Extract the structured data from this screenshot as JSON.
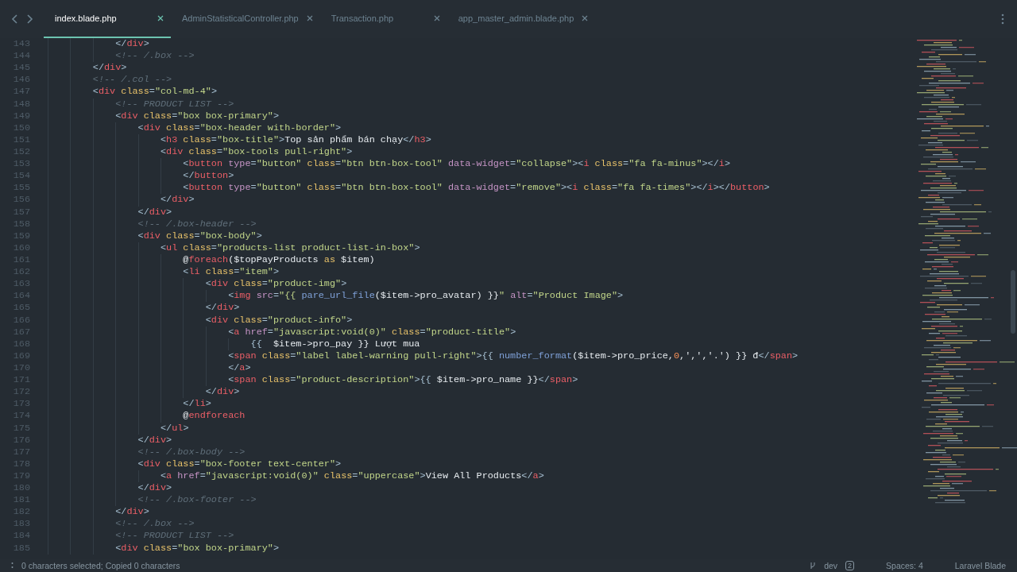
{
  "tabs": [
    {
      "label": "index.blade.php",
      "selected": true
    },
    {
      "label": "AdminStatisticalController.php",
      "selected": false
    },
    {
      "label": "Transaction.php",
      "selected": false
    },
    {
      "label": "app_master_admin.blade.php",
      "selected": false
    }
  ],
  "editor": {
    "lines": [
      {
        "number": "143",
        "tokens": [
          {
            "kind": "p",
            "text": "            </"
          },
          {
            "kind": "tag",
            "text": "div"
          },
          {
            "kind": "p",
            "text": ">"
          }
        ]
      },
      {
        "number": "144",
        "tokens": [
          {
            "kind": "c",
            "text": "            <!-- /.box -->"
          }
        ]
      },
      {
        "number": "145",
        "tokens": [
          {
            "kind": "p",
            "text": "        </"
          },
          {
            "kind": "tag",
            "text": "div"
          },
          {
            "kind": "p",
            "text": ">"
          }
        ]
      },
      {
        "number": "146",
        "tokens": [
          {
            "kind": "c",
            "text": "        <!-- /.col -->"
          }
        ]
      },
      {
        "number": "147",
        "tokens": [
          {
            "kind": "p",
            "text": "        <"
          },
          {
            "kind": "tag",
            "text": "div"
          },
          {
            "kind": "at",
            "text": " class"
          },
          {
            "kind": "p",
            "text": "="
          },
          {
            "kind": "s",
            "text": "\"col-md-4\""
          },
          {
            "kind": "p",
            "text": ">"
          }
        ]
      },
      {
        "number": "148",
        "tokens": [
          {
            "kind": "c",
            "text": "            <!-- PRODUCT LIST -->"
          }
        ]
      },
      {
        "number": "149",
        "tokens": [
          {
            "kind": "p",
            "text": "            <"
          },
          {
            "kind": "tag",
            "text": "div"
          },
          {
            "kind": "at",
            "text": " class"
          },
          {
            "kind": "p",
            "text": "="
          },
          {
            "kind": "s",
            "text": "\"box box-primary\""
          },
          {
            "kind": "p",
            "text": ">"
          }
        ]
      },
      {
        "number": "150",
        "tokens": [
          {
            "kind": "p",
            "text": "                <"
          },
          {
            "kind": "tag",
            "text": "div"
          },
          {
            "kind": "at",
            "text": " class"
          },
          {
            "kind": "p",
            "text": "="
          },
          {
            "kind": "s",
            "text": "\"box-header with-border\""
          },
          {
            "kind": "p",
            "text": ">"
          }
        ]
      },
      {
        "number": "151",
        "tokens": [
          {
            "kind": "p",
            "text": "                    <"
          },
          {
            "kind": "tag",
            "text": "h3"
          },
          {
            "kind": "at",
            "text": " class"
          },
          {
            "kind": "p",
            "text": "="
          },
          {
            "kind": "s",
            "text": "\"box-title\""
          },
          {
            "kind": "p",
            "text": ">"
          },
          {
            "kind": "t",
            "text": "Top sản phẩm bán chạy"
          },
          {
            "kind": "p",
            "text": "</"
          },
          {
            "kind": "tag",
            "text": "h3"
          },
          {
            "kind": "p",
            "text": ">"
          }
        ]
      },
      {
        "number": "152",
        "tokens": [
          {
            "kind": "p",
            "text": "                    <"
          },
          {
            "kind": "tag",
            "text": "div"
          },
          {
            "kind": "at",
            "text": " class"
          },
          {
            "kind": "p",
            "text": "="
          },
          {
            "kind": "s",
            "text": "\"box-tools pull-right\""
          },
          {
            "kind": "p",
            "text": ">"
          }
        ]
      },
      {
        "number": "153",
        "tokens": [
          {
            "kind": "p",
            "text": "                        <"
          },
          {
            "kind": "tag",
            "text": "button"
          },
          {
            "kind": "ap",
            "text": " type"
          },
          {
            "kind": "p",
            "text": "="
          },
          {
            "kind": "s",
            "text": "\"button\""
          },
          {
            "kind": "at",
            "text": " class"
          },
          {
            "kind": "p",
            "text": "="
          },
          {
            "kind": "s",
            "text": "\"btn btn-box-tool\""
          },
          {
            "kind": "ap",
            "text": " data-widget"
          },
          {
            "kind": "p",
            "text": "="
          },
          {
            "kind": "s",
            "text": "\"collapse\""
          },
          {
            "kind": "p",
            "text": "><"
          },
          {
            "kind": "tag",
            "text": "i"
          },
          {
            "kind": "at",
            "text": " class"
          },
          {
            "kind": "p",
            "text": "="
          },
          {
            "kind": "s",
            "text": "\"fa fa-minus\""
          },
          {
            "kind": "p",
            "text": "></"
          },
          {
            "kind": "tag",
            "text": "i"
          },
          {
            "kind": "p",
            "text": ">"
          }
        ]
      },
      {
        "number": "154",
        "tokens": [
          {
            "kind": "p",
            "text": "                        </"
          },
          {
            "kind": "tag",
            "text": "button"
          },
          {
            "kind": "p",
            "text": ">"
          }
        ]
      },
      {
        "number": "155",
        "tokens": [
          {
            "kind": "p",
            "text": "                        <"
          },
          {
            "kind": "tag",
            "text": "button"
          },
          {
            "kind": "ap",
            "text": " type"
          },
          {
            "kind": "p",
            "text": "="
          },
          {
            "kind": "s",
            "text": "\"button\""
          },
          {
            "kind": "at",
            "text": " class"
          },
          {
            "kind": "p",
            "text": "="
          },
          {
            "kind": "s",
            "text": "\"btn btn-box-tool\""
          },
          {
            "kind": "ap",
            "text": " data-widget"
          },
          {
            "kind": "p",
            "text": "="
          },
          {
            "kind": "s",
            "text": "\"remove\""
          },
          {
            "kind": "p",
            "text": "><"
          },
          {
            "kind": "tag",
            "text": "i"
          },
          {
            "kind": "at",
            "text": " class"
          },
          {
            "kind": "p",
            "text": "="
          },
          {
            "kind": "s",
            "text": "\"fa fa-times\""
          },
          {
            "kind": "p",
            "text": "></"
          },
          {
            "kind": "tag",
            "text": "i"
          },
          {
            "kind": "p",
            "text": "></"
          },
          {
            "kind": "tag",
            "text": "button"
          },
          {
            "kind": "p",
            "text": ">"
          }
        ]
      },
      {
        "number": "156",
        "tokens": [
          {
            "kind": "p",
            "text": "                    </"
          },
          {
            "kind": "tag",
            "text": "div"
          },
          {
            "kind": "p",
            "text": ">"
          }
        ]
      },
      {
        "number": "157",
        "tokens": [
          {
            "kind": "p",
            "text": "                </"
          },
          {
            "kind": "tag",
            "text": "div"
          },
          {
            "kind": "p",
            "text": ">"
          }
        ]
      },
      {
        "number": "158",
        "tokens": [
          {
            "kind": "c",
            "text": "                <!-- /.box-header -->"
          }
        ]
      },
      {
        "number": "159",
        "tokens": [
          {
            "kind": "p",
            "text": "                <"
          },
          {
            "kind": "tag",
            "text": "div"
          },
          {
            "kind": "at",
            "text": " class"
          },
          {
            "kind": "p",
            "text": "="
          },
          {
            "kind": "s",
            "text": "\"box-body\""
          },
          {
            "kind": "p",
            "text": ">"
          }
        ]
      },
      {
        "number": "160",
        "tokens": [
          {
            "kind": "p",
            "text": "                    <"
          },
          {
            "kind": "tag",
            "text": "ul"
          },
          {
            "kind": "at",
            "text": " class"
          },
          {
            "kind": "p",
            "text": "="
          },
          {
            "kind": "s",
            "text": "\"products-list product-list-in-box\""
          },
          {
            "kind": "p",
            "text": ">"
          }
        ]
      },
      {
        "number": "161",
        "tokens": [
          {
            "kind": "t",
            "text": "                        @"
          },
          {
            "kind": "kw",
            "text": "foreach"
          },
          {
            "kind": "t",
            "text": "($topPayProducts "
          },
          {
            "kind": "at",
            "text": "as"
          },
          {
            "kind": "t",
            "text": " $item)"
          }
        ]
      },
      {
        "number": "162",
        "tokens": [
          {
            "kind": "p",
            "text": "                        <"
          },
          {
            "kind": "tag",
            "text": "li"
          },
          {
            "kind": "at",
            "text": " class"
          },
          {
            "kind": "p",
            "text": "="
          },
          {
            "kind": "s",
            "text": "\"item\""
          },
          {
            "kind": "p",
            "text": ">"
          }
        ]
      },
      {
        "number": "163",
        "tokens": [
          {
            "kind": "p",
            "text": "                            <"
          },
          {
            "kind": "tag",
            "text": "div"
          },
          {
            "kind": "at",
            "text": " class"
          },
          {
            "kind": "p",
            "text": "="
          },
          {
            "kind": "s",
            "text": "\"product-img\""
          },
          {
            "kind": "p",
            "text": ">"
          }
        ]
      },
      {
        "number": "164",
        "tokens": [
          {
            "kind": "p",
            "text": "                                <"
          },
          {
            "kind": "tag",
            "text": "img"
          },
          {
            "kind": "ap",
            "text": " src"
          },
          {
            "kind": "p",
            "text": "="
          },
          {
            "kind": "s",
            "text": "\"{{ "
          },
          {
            "kind": "fn",
            "text": "pare_url_file"
          },
          {
            "kind": "t",
            "text": "($item->pro_avatar) }}"
          },
          {
            "kind": "s",
            "text": "\""
          },
          {
            "kind": "ap",
            "text": " alt"
          },
          {
            "kind": "p",
            "text": "="
          },
          {
            "kind": "s",
            "text": "\"Product Image\""
          },
          {
            "kind": "p",
            "text": ">"
          }
        ]
      },
      {
        "number": "165",
        "tokens": [
          {
            "kind": "p",
            "text": "                            </"
          },
          {
            "kind": "tag",
            "text": "div"
          },
          {
            "kind": "p",
            "text": ">"
          }
        ]
      },
      {
        "number": "166",
        "tokens": [
          {
            "kind": "p",
            "text": "                            <"
          },
          {
            "kind": "tag",
            "text": "div"
          },
          {
            "kind": "at",
            "text": " class"
          },
          {
            "kind": "p",
            "text": "="
          },
          {
            "kind": "s",
            "text": "\"product-info\""
          },
          {
            "kind": "p",
            "text": ">"
          }
        ]
      },
      {
        "number": "167",
        "tokens": [
          {
            "kind": "p",
            "text": "                                <"
          },
          {
            "kind": "tag",
            "text": "a"
          },
          {
            "kind": "ap",
            "text": " href"
          },
          {
            "kind": "p",
            "text": "="
          },
          {
            "kind": "s",
            "text": "\"javascript:void(0)\""
          },
          {
            "kind": "at",
            "text": " class"
          },
          {
            "kind": "p",
            "text": "="
          },
          {
            "kind": "s",
            "text": "\"product-title\""
          },
          {
            "kind": "p",
            "text": ">"
          }
        ]
      },
      {
        "number": "168",
        "tokens": [
          {
            "kind": "p",
            "text": "                                    {{  "
          },
          {
            "kind": "t",
            "text": "$item->pro_pay }} Lượt mua"
          }
        ]
      },
      {
        "number": "169",
        "tokens": [
          {
            "kind": "p",
            "text": "                                <"
          },
          {
            "kind": "tag",
            "text": "span"
          },
          {
            "kind": "at",
            "text": " class"
          },
          {
            "kind": "p",
            "text": "="
          },
          {
            "kind": "s",
            "text": "\"label label-warning pull-right\""
          },
          {
            "kind": "p",
            "text": ">{{ "
          },
          {
            "kind": "fn",
            "text": "number_format"
          },
          {
            "kind": "t",
            "text": "($item->pro_price,"
          },
          {
            "kind": "n",
            "text": "0"
          },
          {
            "kind": "t",
            "text": ",',','.') }} đ"
          },
          {
            "kind": "p",
            "text": "</"
          },
          {
            "kind": "tag",
            "text": "span"
          },
          {
            "kind": "p",
            "text": ">"
          }
        ]
      },
      {
        "number": "170",
        "tokens": [
          {
            "kind": "p",
            "text": "                                </"
          },
          {
            "kind": "tag",
            "text": "a"
          },
          {
            "kind": "p",
            "text": ">"
          }
        ]
      },
      {
        "number": "171",
        "tokens": [
          {
            "kind": "p",
            "text": "                                <"
          },
          {
            "kind": "tag",
            "text": "span"
          },
          {
            "kind": "at",
            "text": " class"
          },
          {
            "kind": "p",
            "text": "="
          },
          {
            "kind": "s",
            "text": "\"product-description\""
          },
          {
            "kind": "p",
            "text": ">{{ "
          },
          {
            "kind": "t",
            "text": "$item->pro_name }}"
          },
          {
            "kind": "p",
            "text": "</"
          },
          {
            "kind": "tag",
            "text": "span"
          },
          {
            "kind": "p",
            "text": ">"
          }
        ]
      },
      {
        "number": "172",
        "tokens": [
          {
            "kind": "p",
            "text": "                            </"
          },
          {
            "kind": "tag",
            "text": "div"
          },
          {
            "kind": "p",
            "text": ">"
          }
        ]
      },
      {
        "number": "173",
        "tokens": [
          {
            "kind": "p",
            "text": "                        </"
          },
          {
            "kind": "tag",
            "text": "li"
          },
          {
            "kind": "p",
            "text": ">"
          }
        ]
      },
      {
        "number": "174",
        "tokens": [
          {
            "kind": "t",
            "text": "                        @"
          },
          {
            "kind": "kw",
            "text": "endforeach"
          }
        ]
      },
      {
        "number": "175",
        "tokens": [
          {
            "kind": "p",
            "text": "                    </"
          },
          {
            "kind": "tag",
            "text": "ul"
          },
          {
            "kind": "p",
            "text": ">"
          }
        ]
      },
      {
        "number": "176",
        "tokens": [
          {
            "kind": "p",
            "text": "                </"
          },
          {
            "kind": "tag",
            "text": "div"
          },
          {
            "kind": "p",
            "text": ">"
          }
        ]
      },
      {
        "number": "177",
        "tokens": [
          {
            "kind": "c",
            "text": "                <!-- /.box-body -->"
          }
        ]
      },
      {
        "number": "178",
        "tokens": [
          {
            "kind": "p",
            "text": "                <"
          },
          {
            "kind": "tag",
            "text": "div"
          },
          {
            "kind": "at",
            "text": " class"
          },
          {
            "kind": "p",
            "text": "="
          },
          {
            "kind": "s",
            "text": "\"box-footer text-center\""
          },
          {
            "kind": "p",
            "text": ">"
          }
        ]
      },
      {
        "number": "179",
        "tokens": [
          {
            "kind": "p",
            "text": "                    <"
          },
          {
            "kind": "tag",
            "text": "a"
          },
          {
            "kind": "ap",
            "text": " href"
          },
          {
            "kind": "p",
            "text": "="
          },
          {
            "kind": "s",
            "text": "\"javascript:void(0)\""
          },
          {
            "kind": "at",
            "text": " class"
          },
          {
            "kind": "p",
            "text": "="
          },
          {
            "kind": "s",
            "text": "\"uppercase\""
          },
          {
            "kind": "p",
            "text": ">"
          },
          {
            "kind": "t",
            "text": "View All Products"
          },
          {
            "kind": "p",
            "text": "</"
          },
          {
            "kind": "tag",
            "text": "a"
          },
          {
            "kind": "p",
            "text": ">"
          }
        ]
      },
      {
        "number": "180",
        "tokens": [
          {
            "kind": "p",
            "text": "                </"
          },
          {
            "kind": "tag",
            "text": "div"
          },
          {
            "kind": "p",
            "text": ">"
          }
        ]
      },
      {
        "number": "181",
        "tokens": [
          {
            "kind": "c",
            "text": "                <!-- /.box-footer -->"
          }
        ]
      },
      {
        "number": "182",
        "tokens": [
          {
            "kind": "p",
            "text": "            </"
          },
          {
            "kind": "tag",
            "text": "div"
          },
          {
            "kind": "p",
            "text": ">"
          }
        ]
      },
      {
        "number": "183",
        "tokens": [
          {
            "kind": "c",
            "text": "            <!-- /.box -->"
          }
        ]
      },
      {
        "number": "184",
        "tokens": [
          {
            "kind": "c",
            "text": "            <!-- PRODUCT LIST -->"
          }
        ]
      },
      {
        "number": "185",
        "tokens": [
          {
            "kind": "p",
            "text": "            <"
          },
          {
            "kind": "tag",
            "text": "div"
          },
          {
            "kind": "at",
            "text": " class"
          },
          {
            "kind": "p",
            "text": "="
          },
          {
            "kind": "s",
            "text": "\"box box-primary\""
          },
          {
            "kind": "p",
            "text": ">"
          }
        ]
      }
    ]
  },
  "status_bar": {
    "message": "0 characters selected; Copied 0 characters",
    "branch": "dev",
    "branch_badge": "2",
    "indentation": "Spaces: 4",
    "syntax": "Laravel Blade"
  }
}
